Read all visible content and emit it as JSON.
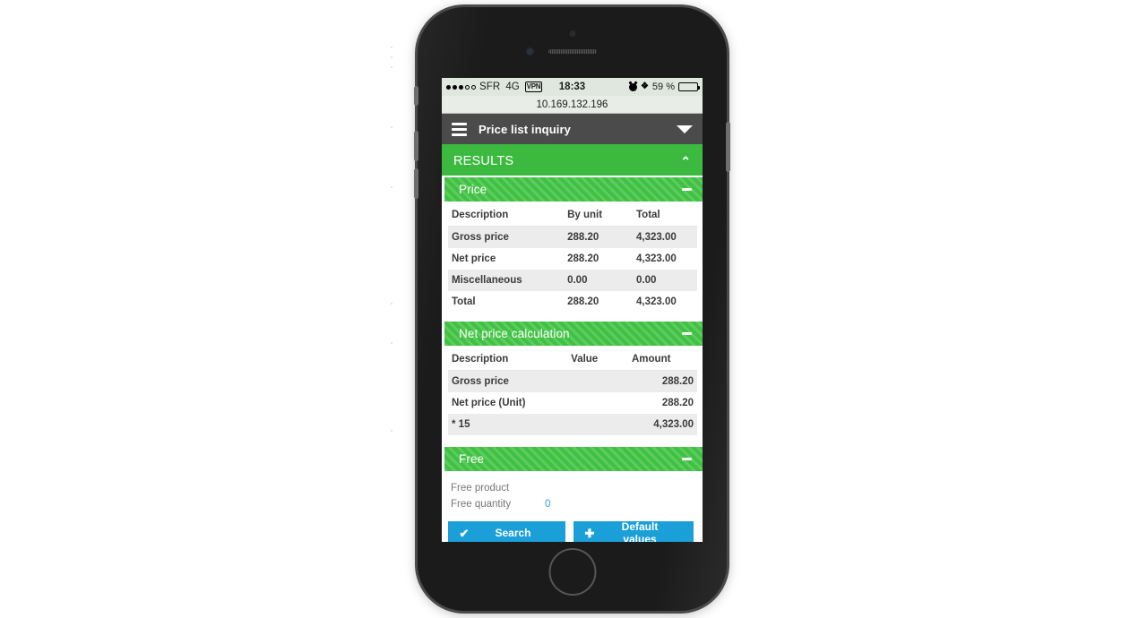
{
  "status_bar": {
    "signal_dots_filled": 3,
    "signal_dots_total": 5,
    "carrier": "SFR",
    "network": "4G",
    "vpn_badge": "VPN",
    "clock": "18:33",
    "alarm_icon": "alarm-clock-icon",
    "bluetooth_icon": "bluetooth-icon",
    "battery_percent_label": "59 %",
    "battery_level": 59
  },
  "browser": {
    "url": "10.169.132.196"
  },
  "navbar": {
    "menu_icon": "hamburger-menu-icon",
    "title": "Price list inquiry",
    "caret_icon": "chevron-down-icon"
  },
  "results": {
    "label": "RESULTS",
    "chevron_icon": "chevron-up-icon",
    "chevron_glyph": "⌃"
  },
  "panels": {
    "price": {
      "title": "Price",
      "collapse_icon": "minus-icon",
      "columns": [
        "Description",
        "By unit",
        "Total"
      ],
      "rows": [
        {
          "description": "Gross price",
          "by_unit": "288.20",
          "total": "4,323.00"
        },
        {
          "description": "Net price",
          "by_unit": "288.20",
          "total": "4,323.00"
        },
        {
          "description": "Miscellaneous",
          "by_unit": "0.00",
          "total": "0.00"
        },
        {
          "description": "Total",
          "by_unit": "288.20",
          "total": "4,323.00"
        }
      ]
    },
    "net_price_calculation": {
      "title": "Net price calculation",
      "collapse_icon": "minus-icon",
      "columns": [
        "Description",
        "Value",
        "Amount"
      ],
      "rows": [
        {
          "description": "Gross price",
          "value": "",
          "amount": "288.20"
        },
        {
          "description": "Net price (Unit)",
          "value": "",
          "amount": "288.20"
        },
        {
          "description": "* 15",
          "value": "",
          "amount": "4,323.00"
        }
      ]
    },
    "free": {
      "title": "Free",
      "collapse_icon": "minus-icon",
      "fields": [
        {
          "label": "Free product",
          "value": ""
        },
        {
          "label": "Free quantity",
          "value": "0"
        }
      ]
    }
  },
  "actions": {
    "search": {
      "label": "Search",
      "icon": "checkmark-icon",
      "glyph": "✔"
    },
    "default_values": {
      "label": "Default values",
      "icon": "plus-icon",
      "glyph": "✚"
    }
  },
  "colors": {
    "brand_green": "#3cba40",
    "panel_green": "#3fc142",
    "navbar_gray": "#4b4b4b",
    "action_blue": "#1b9fd8",
    "value_blue": "#2f9fd8",
    "zebra_gray": "#ececec"
  }
}
